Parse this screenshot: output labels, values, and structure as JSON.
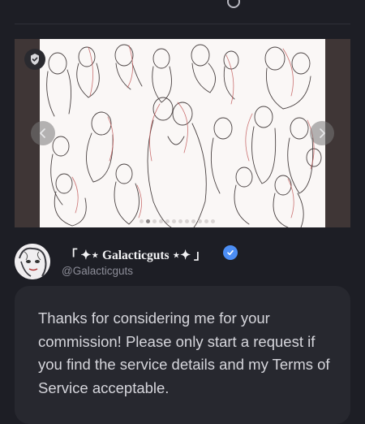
{
  "gallery": {
    "slide_count": 12,
    "active_index": 1,
    "icons": {
      "watermark": "verified-shield-icon",
      "prev": "chevron-left-icon",
      "next": "chevron-right-icon"
    }
  },
  "profile": {
    "display_name": "「 ✦⋆ Galacticguts ⋆✦ 」",
    "handle": "@Galacticguts",
    "verified_icon": "verified-check-icon",
    "accent_color": "#4c8ef5"
  },
  "description": {
    "text": "Thanks for considering me for your commission! Please only start a request if you find the service details and my Terms of Service acceptable."
  }
}
